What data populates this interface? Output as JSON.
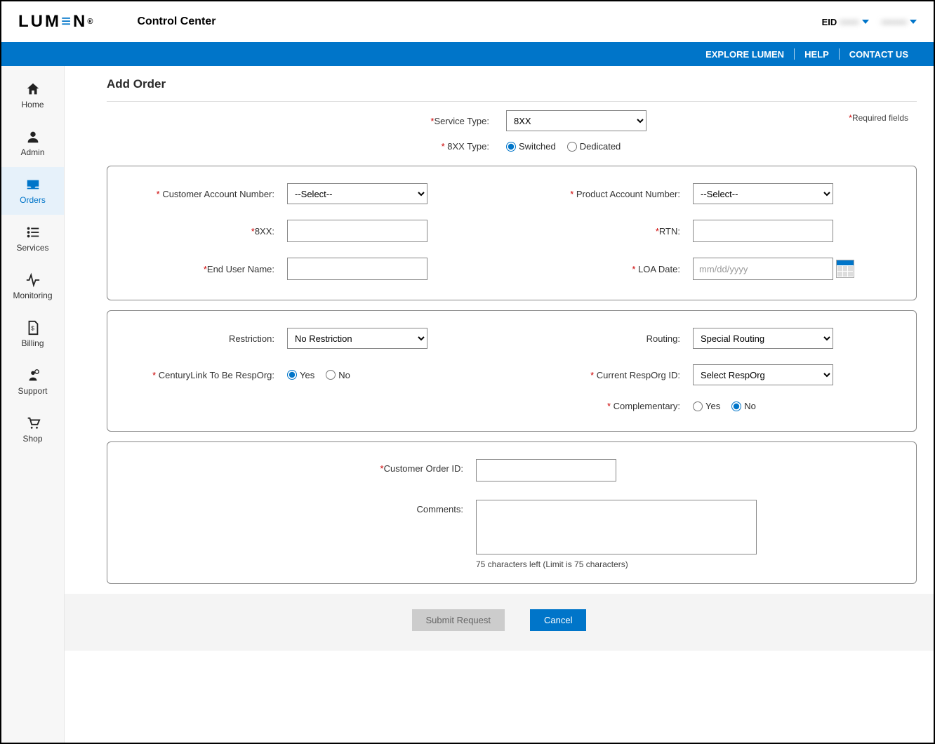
{
  "header": {
    "logo_text": "LUMEN",
    "app_title": "Control Center",
    "eid_label": "EID",
    "eid_value": "••••••",
    "user_value": "••••••••"
  },
  "bluebar": {
    "explore": "EXPLORE LUMEN",
    "help": "HELP",
    "contact": "CONTACT US"
  },
  "sidebar": {
    "items": [
      {
        "label": "Home"
      },
      {
        "label": "Admin"
      },
      {
        "label": "Orders"
      },
      {
        "label": "Services"
      },
      {
        "label": "Monitoring"
      },
      {
        "label": "Billing"
      },
      {
        "label": "Support"
      },
      {
        "label": "Shop"
      }
    ]
  },
  "page": {
    "title": "Add Order",
    "required_note": "Required fields"
  },
  "form": {
    "service_type": {
      "label": "Service Type:",
      "value": "8XX"
    },
    "xx_type": {
      "label": "8XX Type:",
      "opt_switched": "Switched",
      "opt_dedicated": "Dedicated"
    },
    "cust_acct": {
      "label": "Customer Account Number:",
      "value": "--Select--"
    },
    "prod_acct": {
      "label": "Product Account Number:",
      "value": "--Select--"
    },
    "xx": {
      "label": "8XX:",
      "value": ""
    },
    "rtn": {
      "label": "RTN:",
      "value": ""
    },
    "end_user": {
      "label": "End User Name:",
      "value": ""
    },
    "loa_date": {
      "label": "LOA Date:",
      "placeholder": "mm/dd/yyyy",
      "value": ""
    },
    "restriction": {
      "label": "Restriction:",
      "value": "No Restriction"
    },
    "routing": {
      "label": "Routing:",
      "value": "Special Routing"
    },
    "resporg": {
      "label": "CenturyLink To Be RespOrg:",
      "yes": "Yes",
      "no": "No"
    },
    "curr_resporg": {
      "label": "Current RespOrg ID:",
      "value": "Select RespOrg"
    },
    "complementary": {
      "label": "Complementary:",
      "yes": "Yes",
      "no": "No"
    },
    "cust_order_id": {
      "label": "Customer Order ID:",
      "value": ""
    },
    "comments": {
      "label": "Comments:",
      "value": "",
      "counter": "75 characters left (Limit is 75 characters)"
    }
  },
  "buttons": {
    "submit": "Submit Request",
    "cancel": "Cancel"
  }
}
